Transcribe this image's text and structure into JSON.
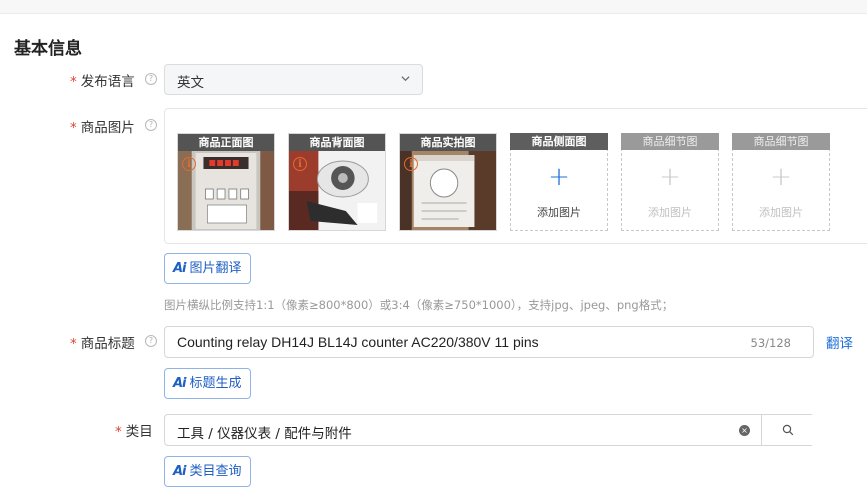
{
  "section": {
    "title": "基本信息"
  },
  "language": {
    "required_mark": "*",
    "label": "发布语言",
    "help": "?",
    "value": "英文"
  },
  "images": {
    "required_mark": "*",
    "label": "商品图片",
    "help": "?",
    "uploaded": [
      {
        "caption": "商品正面图",
        "info": "i"
      },
      {
        "caption": "商品背面图",
        "info": "i"
      },
      {
        "caption": "商品实拍图",
        "info": "i"
      }
    ],
    "slots": [
      {
        "caption": "商品侧面图",
        "plus": "+",
        "add_label": "添加图片"
      },
      {
        "caption": "商品细节图",
        "plus": "+",
        "add_label": "添加图片"
      },
      {
        "caption": "商品细节图",
        "plus": "+",
        "add_label": "添加图片"
      }
    ],
    "translate_button": "图片翻译",
    "hint": "图片横纵比例支持1:1（像素≥800*800）或3:4（像素≥750*1000），支持jpg、jpeg、png格式；"
  },
  "title_field": {
    "required_mark": "*",
    "label": "商品标题",
    "help": "?",
    "value": "Counting relay DH14J BL14J counter AC220/380V 11 pins",
    "count": "53/128",
    "translate_link": "翻译",
    "generate_button": "标题生成"
  },
  "category": {
    "required_mark": "*",
    "label": "类目",
    "value": "工具 / 仪器仪表 / 配件与附件",
    "clear": "×",
    "query_button": "类目查询"
  },
  "ai_icon_text": "Ai"
}
